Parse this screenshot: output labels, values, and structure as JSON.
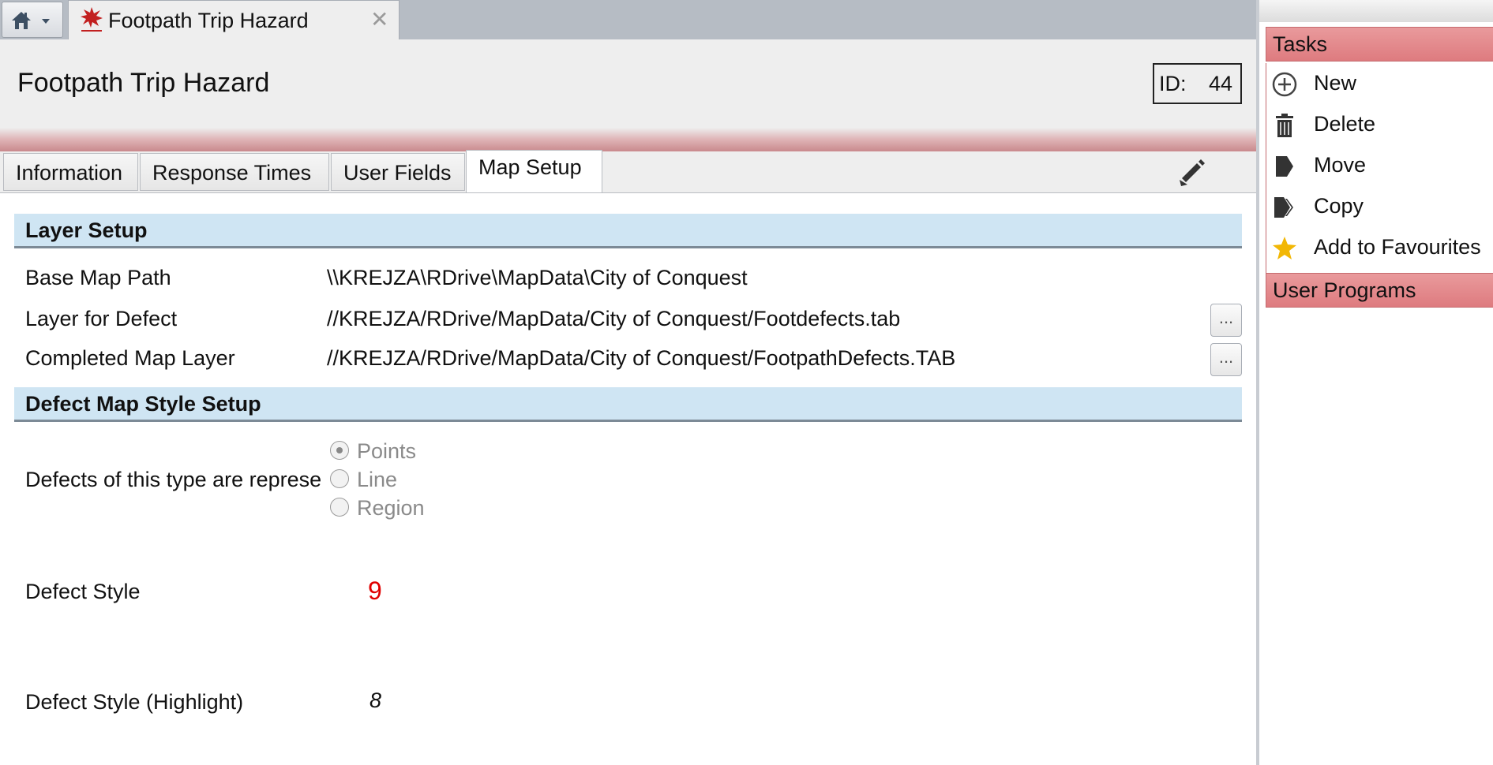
{
  "window": {
    "tab_title": "Footpath Trip Hazard",
    "tab_close": "✕"
  },
  "header": {
    "title": "Footpath Trip Hazard",
    "id_label": "ID:",
    "id_value": "44"
  },
  "tabs": [
    {
      "label": "Information",
      "active": false
    },
    {
      "label": "Response Times",
      "active": false
    },
    {
      "label": "User Fields",
      "active": false
    },
    {
      "label": "Map Setup",
      "active": true
    }
  ],
  "layer_setup": {
    "title": "Layer Setup",
    "base_map_path_label": "Base Map Path",
    "base_map_path_value": "\\\\KREJZA\\RDrive\\MapData\\City of Conquest",
    "layer_for_defect_label": "Layer for Defect",
    "layer_for_defect_value": "//KREJZA/RDrive/MapData/City of Conquest/Footdefects.tab",
    "completed_map_layer_label": "Completed Map Layer",
    "completed_map_layer_value": "//KREJZA/RDrive/MapData/City of Conquest/FootpathDefects.TAB",
    "browse_label": "..."
  },
  "defect_style_setup": {
    "title": "Defect Map Style Setup",
    "represent_label": "Defects of this type are represented as",
    "options": [
      {
        "label": "Points",
        "selected": true
      },
      {
        "label": "Line",
        "selected": false
      },
      {
        "label": "Region",
        "selected": false
      }
    ],
    "defect_style_label": "Defect Style",
    "defect_style_sample": "9",
    "defect_style_color": "#e00000",
    "highlight_label": "Defect Style (Highlight)",
    "highlight_sample": "8",
    "highlight_color": "#111111"
  },
  "right_panel": {
    "tasks_title": "Tasks",
    "tasks": [
      {
        "label": "New",
        "icon": "plus-circle-icon"
      },
      {
        "label": "Delete",
        "icon": "trash-icon"
      },
      {
        "label": "Move",
        "icon": "move-icon"
      },
      {
        "label": "Copy",
        "icon": "copy-icon"
      },
      {
        "label": "Add to Favourites",
        "icon": "star-icon"
      }
    ],
    "user_programs_title": "User Programs"
  },
  "colors": {
    "accent_red": "#de7b7f",
    "section_blue": "#cfe5f3",
    "star_yellow": "#f2b705"
  }
}
